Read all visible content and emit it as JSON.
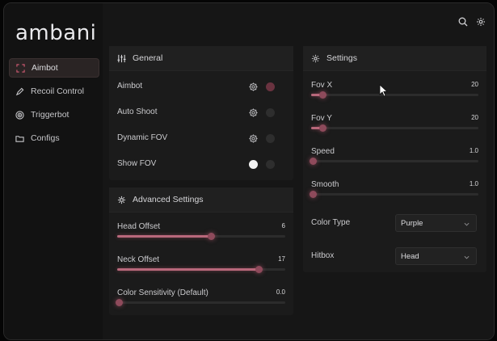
{
  "brand": {
    "logo_text": "ambani"
  },
  "sidebar": {
    "items": [
      {
        "label": "Aimbot",
        "icon": "crosshair-frame-icon",
        "active": true
      },
      {
        "label": "Recoil Control",
        "icon": "pen-icon",
        "active": false
      },
      {
        "label": "Triggerbot",
        "icon": "target-icon",
        "active": false
      },
      {
        "label": "Configs",
        "icon": "folder-icon",
        "active": false
      }
    ]
  },
  "topbar": {
    "icons": [
      "search-icon",
      "gear-icon"
    ]
  },
  "general": {
    "title": "General",
    "rows": [
      {
        "label": "Aimbot",
        "has_gear": true,
        "toggle": "accent"
      },
      {
        "label": "Auto Shoot",
        "has_gear": true,
        "toggle": "off"
      },
      {
        "label": "Dynamic FOV",
        "has_gear": true,
        "toggle": "off"
      },
      {
        "label": "Show FOV",
        "has_gear": false,
        "toggle": "on"
      }
    ]
  },
  "advanced": {
    "title": "Advanced Settings",
    "sliders": [
      {
        "label": "Head Offset",
        "value": "6",
        "fraction": 0.56
      },
      {
        "label": "Neck Offset",
        "value": "17",
        "fraction": 0.84
      },
      {
        "label": "Color Sensitivity (Default)",
        "value": "0.0",
        "fraction": 0.0
      }
    ]
  },
  "settings": {
    "title": "Settings",
    "sliders": [
      {
        "label": "Fov X",
        "value": "20",
        "fraction": 0.07
      },
      {
        "label": "Fov Y",
        "value": "20",
        "fraction": 0.07
      },
      {
        "label": "Speed",
        "value": "1.0",
        "fraction": 0.0
      },
      {
        "label": "Smooth",
        "value": "1.0",
        "fraction": 0.0
      }
    ],
    "selects": [
      {
        "label": "Color Type",
        "value": "Purple"
      },
      {
        "label": "Hitbox",
        "value": "Head"
      }
    ]
  },
  "colors": {
    "accent": "#d35a74",
    "slider_fill": "#b8687b",
    "panel": "#1b1b1b",
    "background": "#141414"
  }
}
